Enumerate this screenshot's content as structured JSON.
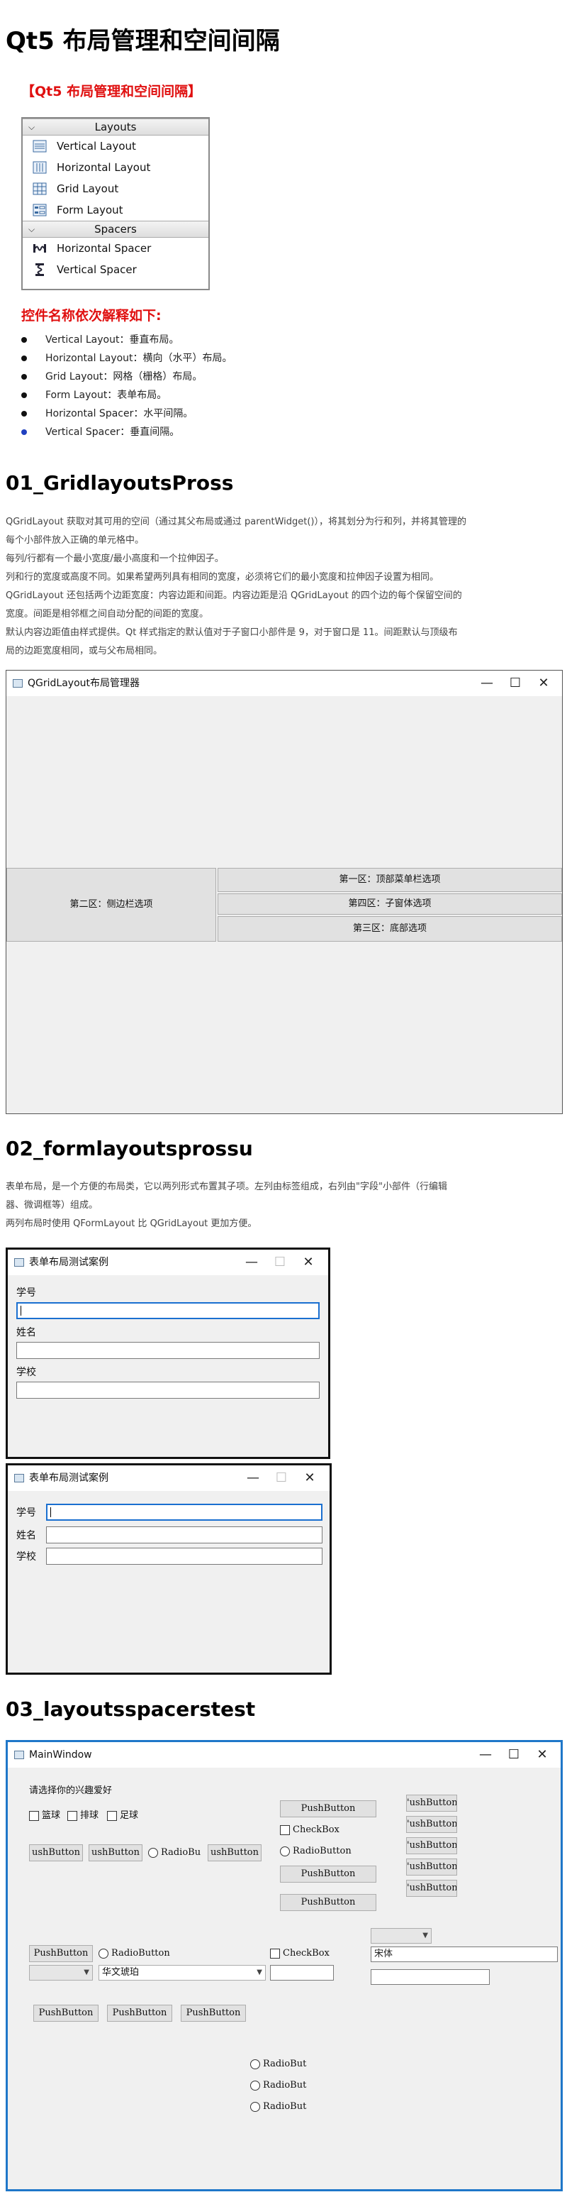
{
  "title": "Qt5 布局管理和空间间隔",
  "subtitle_bracket": "【Qt5 布局管理和空间间隔】",
  "widgetbox": {
    "layouts_header": "Layouts",
    "spacers_header": "Spacers",
    "items": [
      "Vertical Layout",
      "Horizontal Layout",
      "Grid Layout",
      "Form Layout"
    ],
    "spacers": [
      "Horizontal Spacer",
      "Vertical Spacer"
    ]
  },
  "explain_heading": "控件名称依次解释如下:",
  "bullets": [
    "Vertical Layout：垂直布局。",
    "Horizontal Layout：横向（水平）布局。",
    "Grid Layout：网格（栅格）布局。",
    "Form Layout：表单布局。",
    "Horizontal Spacer：水平间隔。",
    "Vertical Spacer：垂直间隔。"
  ],
  "sec1": {
    "heading": "01_GridlayoutsPross",
    "lines": [
      "QGridLayout 获取对其可用的空间（通过其父布局或通过 parentWidget()），将其划分为行和列，并将其管理的",
      "每个小部件放入正确的单元格中。",
      "每列/行都有一个最小宽度/最小高度和一个拉伸因子。",
      "列和行的宽度或高度不同。如果希望两列具有相同的宽度，必须将它们的最小宽度和拉伸因子设置为相同。",
      "QGridLayout 还包括两个边距宽度：内容边距和间距。内容边距是沿 QGridLayout 的四个边的每个保留空间的",
      "宽度。间距是相邻框之间自动分配的间距的宽度。",
      "默认内容边距值由样式提供。Qt 样式指定的默认值对于子窗口小部件是 9，对于窗口是 11。间距默认与顶级布",
      "局的边距宽度相同，或与父布局相同。"
    ],
    "window_title": "QGridLayout布局管理器",
    "btn_left": "第二区：侧边栏选项",
    "btn_r1": "第一区：顶部菜单栏选项",
    "btn_r2": "第四区：子窗体选项",
    "btn_r3": "第三区：底部选项"
  },
  "sec2": {
    "heading": "02_formlayoutsprossu",
    "lines": [
      "表单布局，是一个方便的布局类，它以两列形式布置其子项。左列由标签组成，右列由\"字段\"小部件（行编辑",
      "器、微调框等）组成。",
      "两列布局时使用 QFormLayout 比 QGridLayout 更加方便。"
    ],
    "window_title": "表单布局测试案例",
    "labels": [
      "学号",
      "姓名",
      "学校"
    ]
  },
  "sec3": {
    "heading": "03_layoutsspacerstest",
    "window_title": "MainWindow",
    "prompt": "请选择你的兴趣爱好",
    "hobbies": [
      "篮球",
      "排球",
      "足球"
    ],
    "pushbutton": "PushButton",
    "pushbutton_clipped": "ushButton",
    "pushbutton_clipped2": "'ushButton",
    "radiobutton": "RadioButton",
    "radio_clipped": "RadioBu",
    "radio_short": "RadioBut",
    "checkbox": "CheckBox",
    "combo_font": "华文琥珀",
    "font_field": "宋体"
  }
}
